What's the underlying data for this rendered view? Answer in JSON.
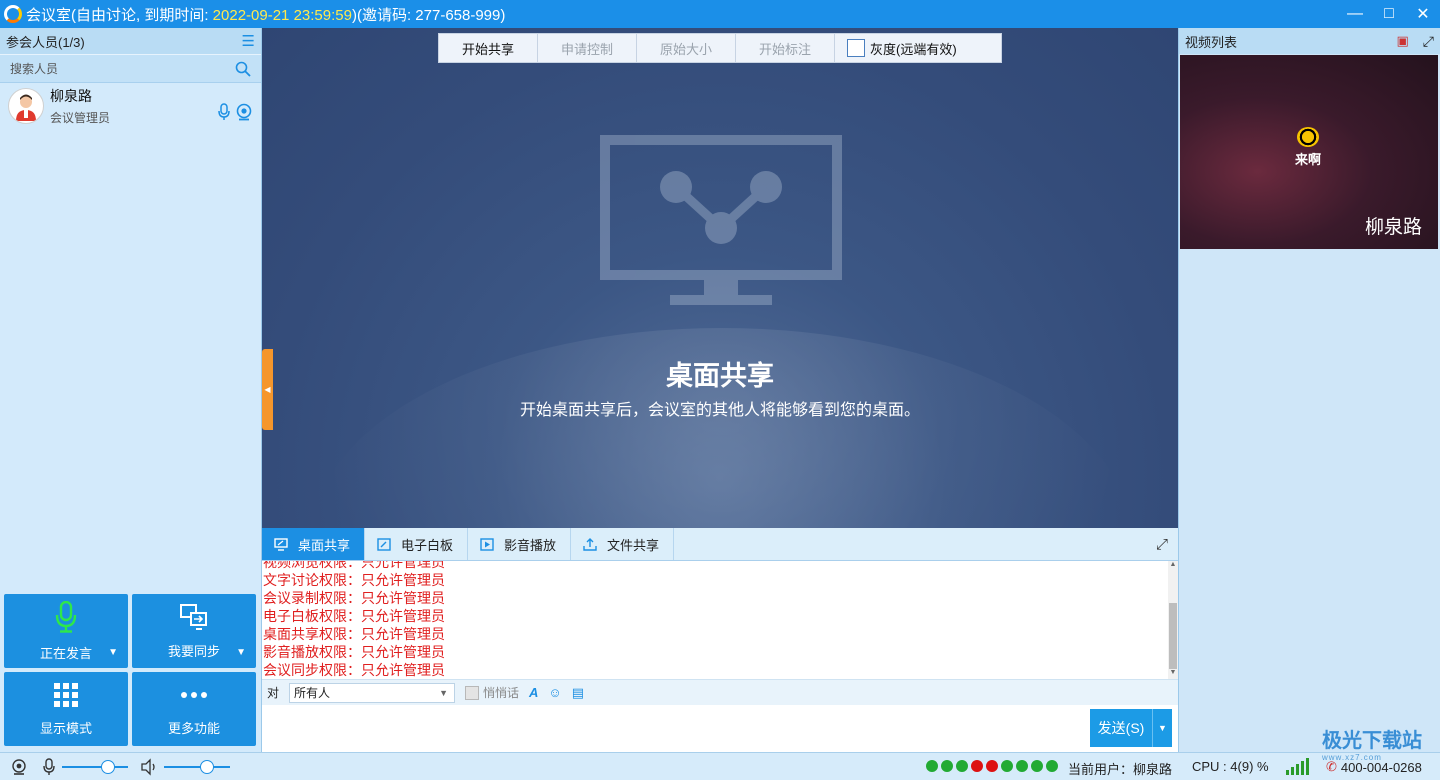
{
  "window": {
    "title_prefix": "会议室(自由讨论, 到期时间: ",
    "expiry": "2022-09-21 23:59:59",
    "title_suffix": ")(邀请码: 277-658-999)",
    "min_icon": "minimize-icon",
    "max_icon": "maximize-icon",
    "close_icon": "close-icon"
  },
  "participants": {
    "header": "参会人员(1/3)",
    "search_placeholder": "搜索人员",
    "members": [
      {
        "name": "柳泉路",
        "role": "会议管理员"
      }
    ]
  },
  "actions": [
    {
      "label": "正在发言",
      "icon": "microphone-icon"
    },
    {
      "label": "我要同步",
      "icon": "sync-screen-icon"
    },
    {
      "label": "显示模式",
      "icon": "grid-icon"
    },
    {
      "label": "更多功能",
      "icon": "more-icon"
    }
  ],
  "toolbar": {
    "start_share": "开始共享",
    "request_control": "申请控制",
    "original_size": "原始大小",
    "start_annotate": "开始标注",
    "grayscale": "灰度(远端有效)"
  },
  "stage": {
    "title": "桌面共享",
    "subtitle": "开始桌面共享后，会议室的其他人将能够看到您的桌面。"
  },
  "tabs": [
    {
      "label": "桌面共享",
      "icon": "desktop-share-icon"
    },
    {
      "label": "电子白板",
      "icon": "whiteboard-icon"
    },
    {
      "label": "影音播放",
      "icon": "media-play-icon"
    },
    {
      "label": "文件共享",
      "icon": "file-share-icon"
    }
  ],
  "log_lines": [
    "视频浏览权限：只允许管理员",
    "文字讨论权限：只允许管理员",
    "会议录制权限：只允许管理员",
    "电子白板权限：只允许管理员",
    "桌面共享权限：只允许管理员",
    "影音播放权限：只允许管理员",
    "会议同步权限：只允许管理员"
  ],
  "chat": {
    "to_label": "对",
    "recipient": "所有人",
    "whisper": "悄悄话",
    "send": "发送(S)"
  },
  "video_list": {
    "header": "视频列表",
    "logo_text": "来啊",
    "user_name": "柳泉路"
  },
  "status": {
    "volume_mic": 0.75,
    "volume_speaker": 0.7,
    "network_dots": [
      "#22aa33",
      "#22aa33",
      "#22aa33",
      "#dd1111",
      "#dd1111",
      "#22aa33",
      "#22aa33",
      "#22aa33",
      "#22aa33"
    ],
    "current_user": "当前用户：柳泉路",
    "cpu": "CPU : 4(9) %",
    "phone": "400-004-0268",
    "watermark": "极光下载站",
    "watermark_sub": "www.xz7.com"
  },
  "colors": {
    "accent": "#1c8fe3",
    "log_text": "#e02020",
    "expiry_highlight": "#ffe94d"
  }
}
